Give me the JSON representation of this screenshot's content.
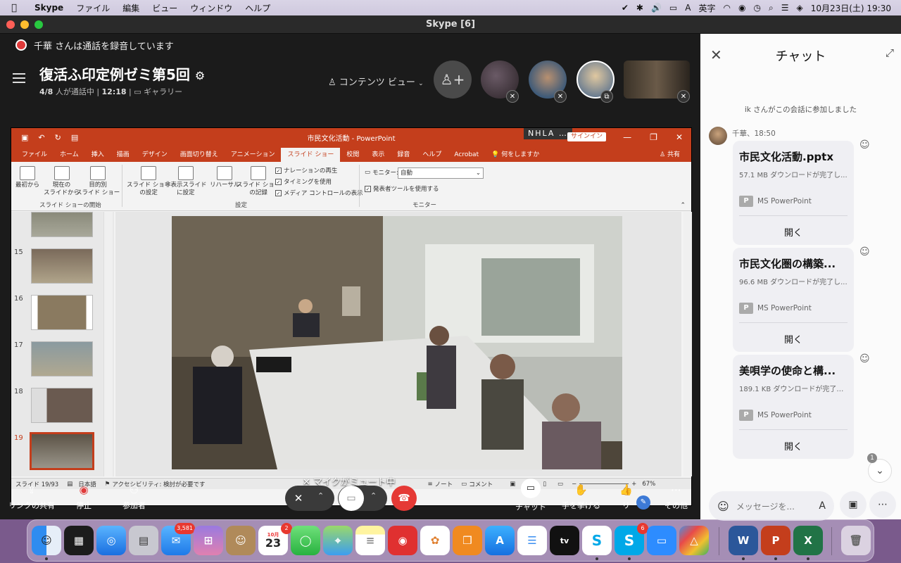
{
  "menubar": {
    "app_name": "Skype",
    "items": [
      "ファイル",
      "編集",
      "ビュー",
      "ウィンドウ",
      "ヘルプ"
    ],
    "input_mode": "英字",
    "datetime": "10月23日(土)  19:30"
  },
  "window": {
    "title": "Skype [6]"
  },
  "call": {
    "recording_notice": "千華 さんは通話を録音しています",
    "title": "復活ふ印定例ゼミ第5回",
    "status_count": "4/8",
    "status_text": "人が通話中",
    "duration": "12:18",
    "layout_label": "ギャラリー",
    "view_mode": "コンテンツ ビュー",
    "mute_tip": "マイクがミュート中"
  },
  "powerpoint": {
    "window_title": "市民文化活動 - PowerPoint",
    "overlay_label": "NHLA …",
    "signin": "サインイン",
    "tabs": [
      "ファイル",
      "ホーム",
      "挿入",
      "描画",
      "デザイン",
      "画面切り替え",
      "アニメーション",
      "スライド ショー",
      "校閲",
      "表示",
      "録音",
      "ヘルプ",
      "Acrobat",
      "何をしますか"
    ],
    "active_tab": "スライド ショー",
    "share_label": "共有",
    "ribbon": {
      "from_start": "最初から",
      "from_current_1": "現在の",
      "from_current_2": "スライドから",
      "custom_1": "目的別",
      "custom_2": "スライド ショー",
      "group_start": "スライド ショーの開始",
      "setup_1": "スライド ショー",
      "setup_2": "の設定",
      "hide_1": "非表示スライド",
      "hide_2": "に設定",
      "rehearse": "リハーサル",
      "record_1": "スライド ショー",
      "record_2": "の記録",
      "opt_narration": "ナレーションの再生",
      "opt_timing": "タイミングを使用",
      "opt_media": "メディア コントロールの表示",
      "group_setup": "設定",
      "monitor_label": "モニター:",
      "monitor_value": "自動",
      "presenter_view": "発表者ツールを使用する",
      "group_monitor": "モニター"
    },
    "slide_numbers": [
      "15",
      "16",
      "17",
      "18",
      "19"
    ],
    "status": {
      "slide": "スライド 19/93",
      "language": "日本語",
      "accessibility": "アクセシビリティ: 検討が必要です",
      "notes": "ノート",
      "comments": "コメント",
      "zoom": "67%"
    }
  },
  "controls": {
    "share_link": "リンクの共有",
    "stop": "停止",
    "participants": "参加者",
    "chat": "チャット",
    "raise_hand": "手を挙げる",
    "react": "リ",
    "more": "その他"
  },
  "chat": {
    "title": "チャット",
    "system_message": "ik さんがこの会話に参加しました",
    "sender": "千華、18:50",
    "files": [
      {
        "name": "市民文化活動.pptx",
        "size": "57.1 MB ダウンロードが完了し...",
        "type": "MS PowerPoint",
        "action": "開く"
      },
      {
        "name": "市民文化圏の構築...",
        "size": "96.6 MB ダウンロードが完了し...",
        "type": "MS PowerPoint",
        "action": "開く"
      },
      {
        "name": "美唄学の使命と構...",
        "size": "189.1 KB ダウンロードが完了し...",
        "type": "MS PowerPoint",
        "action": "開く"
      }
    ],
    "unread_count": "1",
    "compose_placeholder": "メッセージを..."
  },
  "dock": {
    "mail_badge": "3,581",
    "calendar_month": "10月",
    "calendar_day": "23",
    "calendar_badge": "2",
    "skype_badge": "6"
  },
  "colors": {
    "ppt_accent": "#c43e1c",
    "end_call": "#e53935",
    "record_dot": "#e03b3b"
  }
}
